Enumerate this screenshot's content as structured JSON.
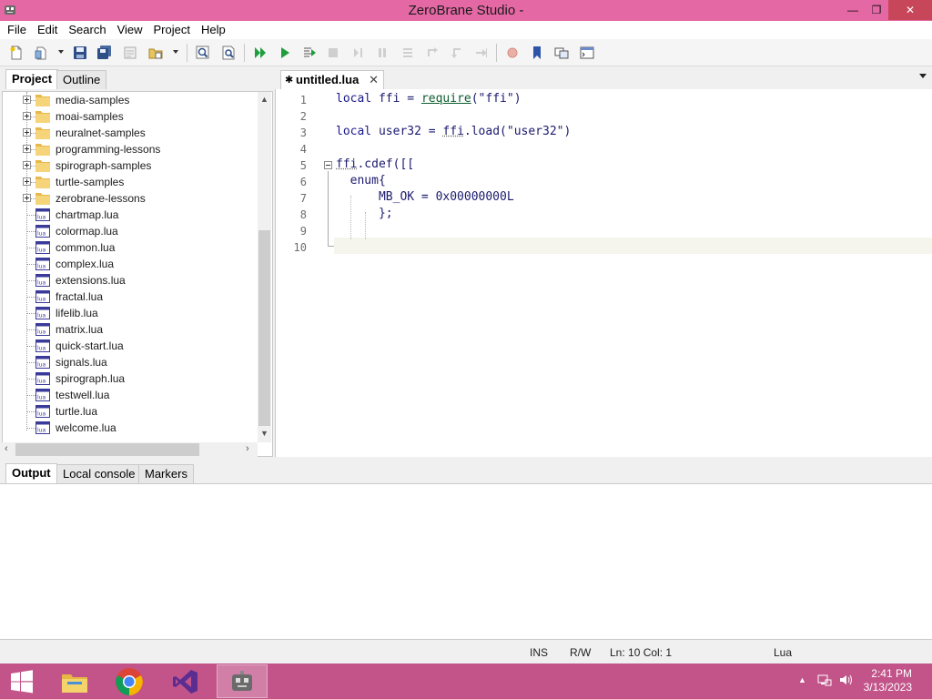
{
  "window": {
    "title": "ZeroBrane Studio -",
    "controls": {
      "minimize": "—",
      "restore": "❐",
      "close": "✕"
    }
  },
  "menu": [
    "File",
    "Edit",
    "Search",
    "View",
    "Project",
    "Help"
  ],
  "toolbar": {
    "icons": [
      "new-file",
      "open-file",
      "save",
      "save-all",
      "project-directory",
      "browse",
      "find",
      "find-in-files",
      "start-debugging",
      "run",
      "run-to-cursor",
      "stop",
      "step-over",
      "break",
      "step-into",
      "step-out",
      "step-into-line",
      "toggle-breakpoint",
      "toggle-bookmark",
      "scratchpad",
      "console"
    ]
  },
  "left_panel": {
    "tabs": [
      "Project",
      "Outline"
    ],
    "active_tab": "Project",
    "tree": [
      {
        "label": "media-samples",
        "type": "folder"
      },
      {
        "label": "moai-samples",
        "type": "folder"
      },
      {
        "label": "neuralnet-samples",
        "type": "folder"
      },
      {
        "label": "programming-lessons",
        "type": "folder"
      },
      {
        "label": "spirograph-samples",
        "type": "folder"
      },
      {
        "label": "turtle-samples",
        "type": "folder"
      },
      {
        "label": "zerobrane-lessons",
        "type": "folder"
      },
      {
        "label": "chartmap.lua",
        "type": "file"
      },
      {
        "label": "colormap.lua",
        "type": "file"
      },
      {
        "label": "common.lua",
        "type": "file"
      },
      {
        "label": "complex.lua",
        "type": "file"
      },
      {
        "label": "extensions.lua",
        "type": "file"
      },
      {
        "label": "fractal.lua",
        "type": "file"
      },
      {
        "label": "lifelib.lua",
        "type": "file"
      },
      {
        "label": "matrix.lua",
        "type": "file"
      },
      {
        "label": "quick-start.lua",
        "type": "file"
      },
      {
        "label": "signals.lua",
        "type": "file"
      },
      {
        "label": "spirograph.lua",
        "type": "file"
      },
      {
        "label": "testwell.lua",
        "type": "file"
      },
      {
        "label": "turtle.lua",
        "type": "file"
      },
      {
        "label": "welcome.lua",
        "type": "file"
      }
    ]
  },
  "editor": {
    "tab_label": "untitled.lua",
    "tab_close": "✕",
    "lines": [
      "local ffi = require(\"ffi\")",
      "",
      "local user32 = ffi.load(\"user32\")",
      "",
      "ffi.cdef([[",
      "  enum{",
      "      MB_OK = 0x00000000L",
      "      };",
      "",
      ""
    ],
    "line_numbers": [
      "1",
      "2",
      "3",
      "4",
      "5",
      "6",
      "7",
      "8",
      "9",
      "10"
    ]
  },
  "bottom_panel": {
    "tabs": [
      "Output",
      "Local console",
      "Markers"
    ],
    "active_tab": "Output"
  },
  "status": {
    "mode": "INS",
    "access": "R/W",
    "position": "Ln: 10 Col: 1",
    "language": "Lua"
  },
  "taskbar": {
    "apps": [
      "windows-start",
      "file-explorer",
      "chrome",
      "visual-studio",
      "zerobrane-studio"
    ],
    "time": "2:41 PM",
    "date": "3/13/2023"
  },
  "colors": {
    "titlebar": "#e468a4",
    "taskbar": "#c2548a",
    "close_button": "#c7465a"
  }
}
